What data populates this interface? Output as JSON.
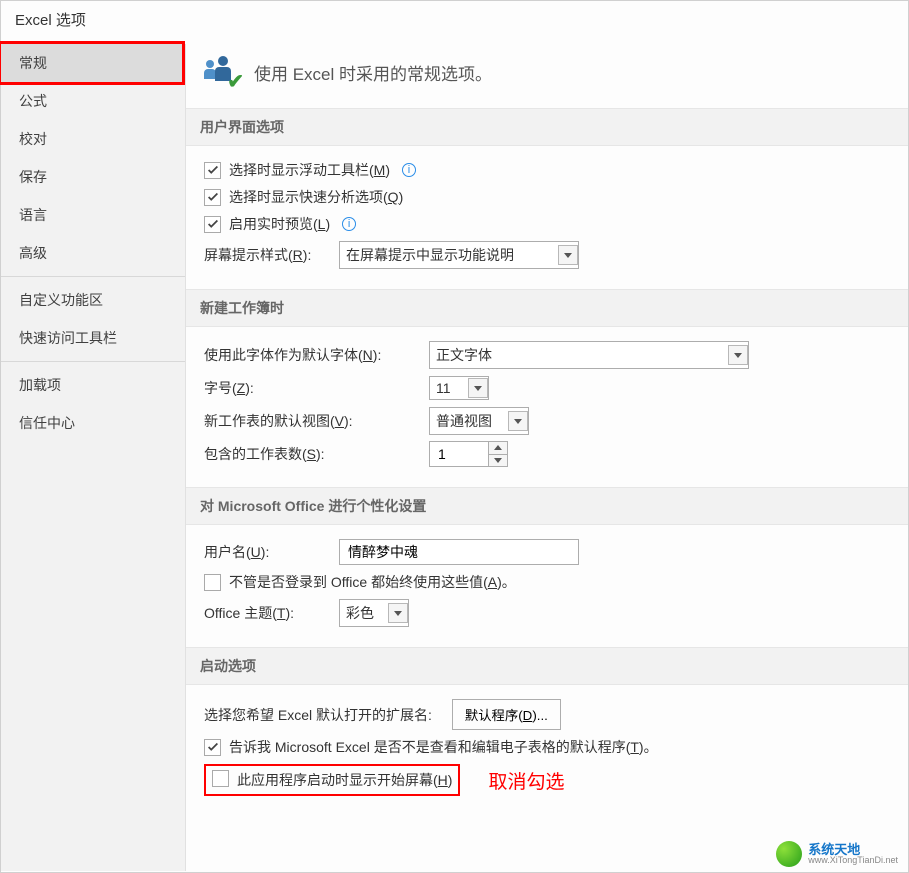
{
  "window": {
    "title": "Excel 选项"
  },
  "sidebar": {
    "items": [
      {
        "label": "常规",
        "selected": true
      },
      {
        "label": "公式"
      },
      {
        "label": "校对"
      },
      {
        "label": "保存"
      },
      {
        "label": "语言"
      },
      {
        "label": "高级"
      }
    ],
    "group2": [
      {
        "label": "自定义功能区"
      },
      {
        "label": "快速访问工具栏"
      }
    ],
    "group3": [
      {
        "label": "加载项"
      },
      {
        "label": "信任中心"
      }
    ]
  },
  "main": {
    "header": "使用 Excel 时采用的常规选项。",
    "sections": {
      "ui": {
        "title": "用户界面选项",
        "miniToolbar": {
          "label_pre": "选择时显示浮动工具栏(",
          "key": "M",
          "label_post": ")",
          "checked": true
        },
        "quickAnalysis": {
          "label_pre": "选择时显示快速分析选项(",
          "key": "Q",
          "label_post": ")",
          "checked": true
        },
        "livePreview": {
          "label_pre": "启用实时预览(",
          "key": "L",
          "label_post": ")",
          "checked": true
        },
        "screenTip": {
          "label_pre": "屏幕提示样式(",
          "key": "R",
          "label_post": "):",
          "value": "在屏幕提示中显示功能说明"
        }
      },
      "newbook": {
        "title": "新建工作簿时",
        "defaultFont": {
          "label_pre": "使用此字体作为默认字体(",
          "key": "N",
          "label_post": "):",
          "value": "正文字体"
        },
        "fontSize": {
          "label_pre": "字号(",
          "key": "Z",
          "label_post": "):",
          "value": "11"
        },
        "defaultView": {
          "label_pre": "新工作表的默认视图(",
          "key": "V",
          "label_post": "):",
          "value": "普通视图"
        },
        "sheetCount": {
          "label_pre": "包含的工作表数(",
          "key": "S",
          "label_post": "):",
          "value": "1"
        }
      },
      "personalize": {
        "title": "对 Microsoft Office 进行个性化设置",
        "username": {
          "label_pre": "用户名(",
          "key": "U",
          "label_post": "):",
          "value": "情醉梦中魂"
        },
        "alwaysUse": {
          "label_pre": "不管是否登录到 Office 都始终使用这些值(",
          "key": "A",
          "label_post": ")。",
          "checked": false
        },
        "theme": {
          "label_pre": "Office 主题(",
          "key": "T",
          "label_post": "):",
          "value": "彩色"
        }
      },
      "startup": {
        "title": "启动选项",
        "defaultExt": {
          "label": "选择您希望 Excel 默认打开的扩展名:",
          "button_pre": "默认程序(",
          "button_key": "D",
          "button_post": ")..."
        },
        "tellMe": {
          "label_pre": "告诉我 Microsoft Excel 是否不是查看和编辑电子表格的默认程序(",
          "key": "T",
          "label_post": ")。",
          "checked": true
        },
        "showStart": {
          "label_pre": "此应用程序启动时显示开始屏幕(",
          "key": "H",
          "label_post": ")",
          "checked": false
        }
      }
    }
  },
  "annotation": "取消勾选",
  "stamp": {
    "line1": "系统天地",
    "line2": "www.XiTongTianDi.net"
  }
}
